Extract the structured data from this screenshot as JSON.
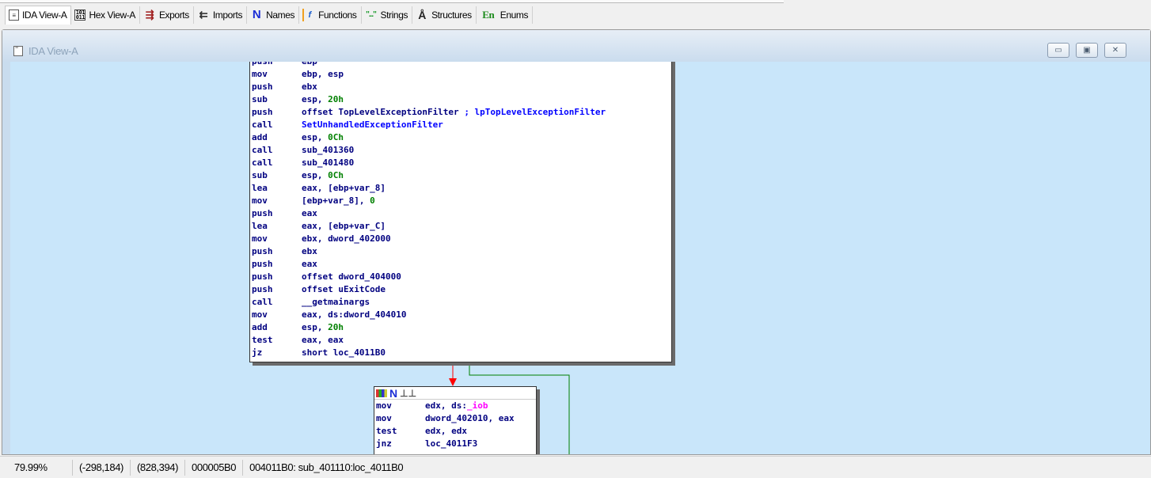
{
  "tabs": [
    {
      "label": "IDA View-A",
      "icon": "document-icon",
      "active": true
    },
    {
      "label": "Hex View-A",
      "icon": "hex-icon",
      "active": false
    },
    {
      "label": "Exports",
      "icon": "exports-icon",
      "active": false
    },
    {
      "label": "Imports",
      "icon": "imports-icon",
      "active": false
    },
    {
      "label": "Names",
      "icon": "names-icon",
      "icon_glyph": "N",
      "active": false
    },
    {
      "label": "Functions",
      "icon": "functions-icon",
      "icon_glyph": "f",
      "active": false
    },
    {
      "label": "Strings",
      "icon": "strings-icon",
      "icon_glyph": "\"...\"",
      "active": false
    },
    {
      "label": "Structures",
      "icon": "structures-icon",
      "active": false
    },
    {
      "label": "Enums",
      "icon": "enums-icon",
      "icon_glyph": "En",
      "active": false
    }
  ],
  "window": {
    "title": "IDA View-A",
    "buttons": [
      "minimize",
      "restore",
      "close"
    ]
  },
  "graph": {
    "block1": [
      [
        "push",
        "ebp"
      ],
      [
        "mov",
        "ebp, esp"
      ],
      [
        "push",
        "ebx"
      ],
      [
        "sub",
        "esp, 20h"
      ],
      [
        "push",
        "offset TopLevelExceptionFilter ; lpTopLevelExceptionFilter"
      ],
      [
        "call",
        "SetUnhandledExceptionFilter"
      ],
      [
        "add",
        "esp, 0Ch"
      ],
      [
        "call",
        "sub_401360"
      ],
      [
        "call",
        "sub_401480"
      ],
      [
        "sub",
        "esp, 0Ch"
      ],
      [
        "lea",
        "eax, [ebp+var_8]"
      ],
      [
        "mov",
        "[ebp+var_8], 0"
      ],
      [
        "push",
        "eax"
      ],
      [
        "lea",
        "eax, [ebp+var_C]"
      ],
      [
        "mov",
        "ebx, dword_402000"
      ],
      [
        "push",
        "ebx"
      ],
      [
        "push",
        "eax"
      ],
      [
        "push",
        "offset dword_404000"
      ],
      [
        "push",
        "offset uExitCode"
      ],
      [
        "call",
        "__getmainargs"
      ],
      [
        "mov",
        "eax, ds:dword_404010"
      ],
      [
        "add",
        "esp, 20h"
      ],
      [
        "test",
        "eax, eax"
      ],
      [
        "jz",
        "short loc_4011B0"
      ]
    ],
    "block2": [
      [
        "mov",
        "edx, ds:_iob"
      ],
      [
        "mov",
        "dword_402010, eax"
      ],
      [
        "test",
        "edx, edx"
      ],
      [
        "jnz",
        "loc_4011F3"
      ]
    ],
    "colors": {
      "background": "#c9e6fa",
      "edge_false": "#ff0000",
      "edge_true": "#008000",
      "instruction": "#000080",
      "number": "#008000",
      "import": "#ff00ff"
    }
  },
  "status": {
    "zoom": "79.99%",
    "coords1": "(-298,184)",
    "coords2": "(828,394)",
    "offset": "000005B0",
    "location": "004011B0: sub_401110:loc_4011B0"
  }
}
